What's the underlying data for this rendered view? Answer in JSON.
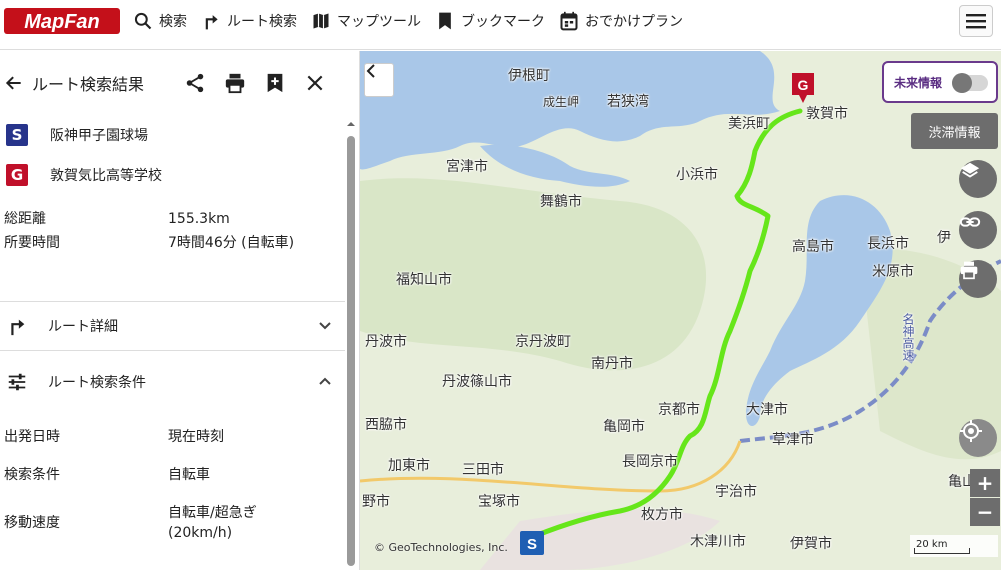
{
  "header": {
    "logo_text": "MapFan",
    "nav": [
      {
        "label": "検索",
        "icon": "search-icon"
      },
      {
        "label": "ルート検索",
        "icon": "route-icon"
      },
      {
        "label": "マップツール",
        "icon": "map-icon"
      },
      {
        "label": "ブックマーク",
        "icon": "bookmark-icon"
      },
      {
        "label": "おでかけプラン",
        "icon": "calendar-icon"
      }
    ],
    "menu_icon": "hamburger-icon"
  },
  "sidebar": {
    "title": "ルート検索結果",
    "actions": [
      "share-icon",
      "print-icon",
      "bookmark-add-icon",
      "close-icon"
    ],
    "start": {
      "badge": "S",
      "name": "阪神甲子園球場"
    },
    "goal": {
      "badge": "G",
      "name": "敦賀気比高等学校"
    },
    "stats": [
      {
        "label": "総距離",
        "value": "155.3km"
      },
      {
        "label": "所要時間",
        "value": "7時間46分 (自転車)"
      }
    ],
    "route_detail": "ルート詳細",
    "route_conditions": "ルート検索条件",
    "conditions": [
      {
        "label": "出発日時",
        "value": "現在時刻"
      },
      {
        "label": "検索条件",
        "value": "自転車"
      },
      {
        "label": "移動速度",
        "value": "自転車/超急ぎ",
        "value2": "(20km/h)"
      }
    ]
  },
  "map": {
    "future_info": "未来情報",
    "traffic": "渋滞情報",
    "copyright": "© GeoTechnologies, Inc.",
    "scale": "20 km",
    "zoom_in": "+",
    "zoom_out": "−",
    "labels": [
      "伊根町",
      "成生岬",
      "若狭湾",
      "美浜町",
      "敦賀市",
      "宮津市",
      "小浜市",
      "舞鶴市",
      "高島市",
      "長浜市",
      "米原市",
      "伊",
      "福知山市",
      "丹波市",
      "京丹波町",
      "南丹市",
      "丹波篠山市",
      "京都市",
      "大津市",
      "西脇市",
      "亀岡市",
      "草津市",
      "加東市",
      "三田市",
      "長岡京市",
      "宇治市",
      "亀山市",
      "野市",
      "宝塚市",
      "枚方市",
      "木津川市",
      "伊賀市",
      "名神高速"
    ],
    "colors": {
      "route": "#66e61a",
      "lake": "#a9c7e8",
      "start": "#1f5fb3",
      "goal": "#c0102a"
    }
  }
}
